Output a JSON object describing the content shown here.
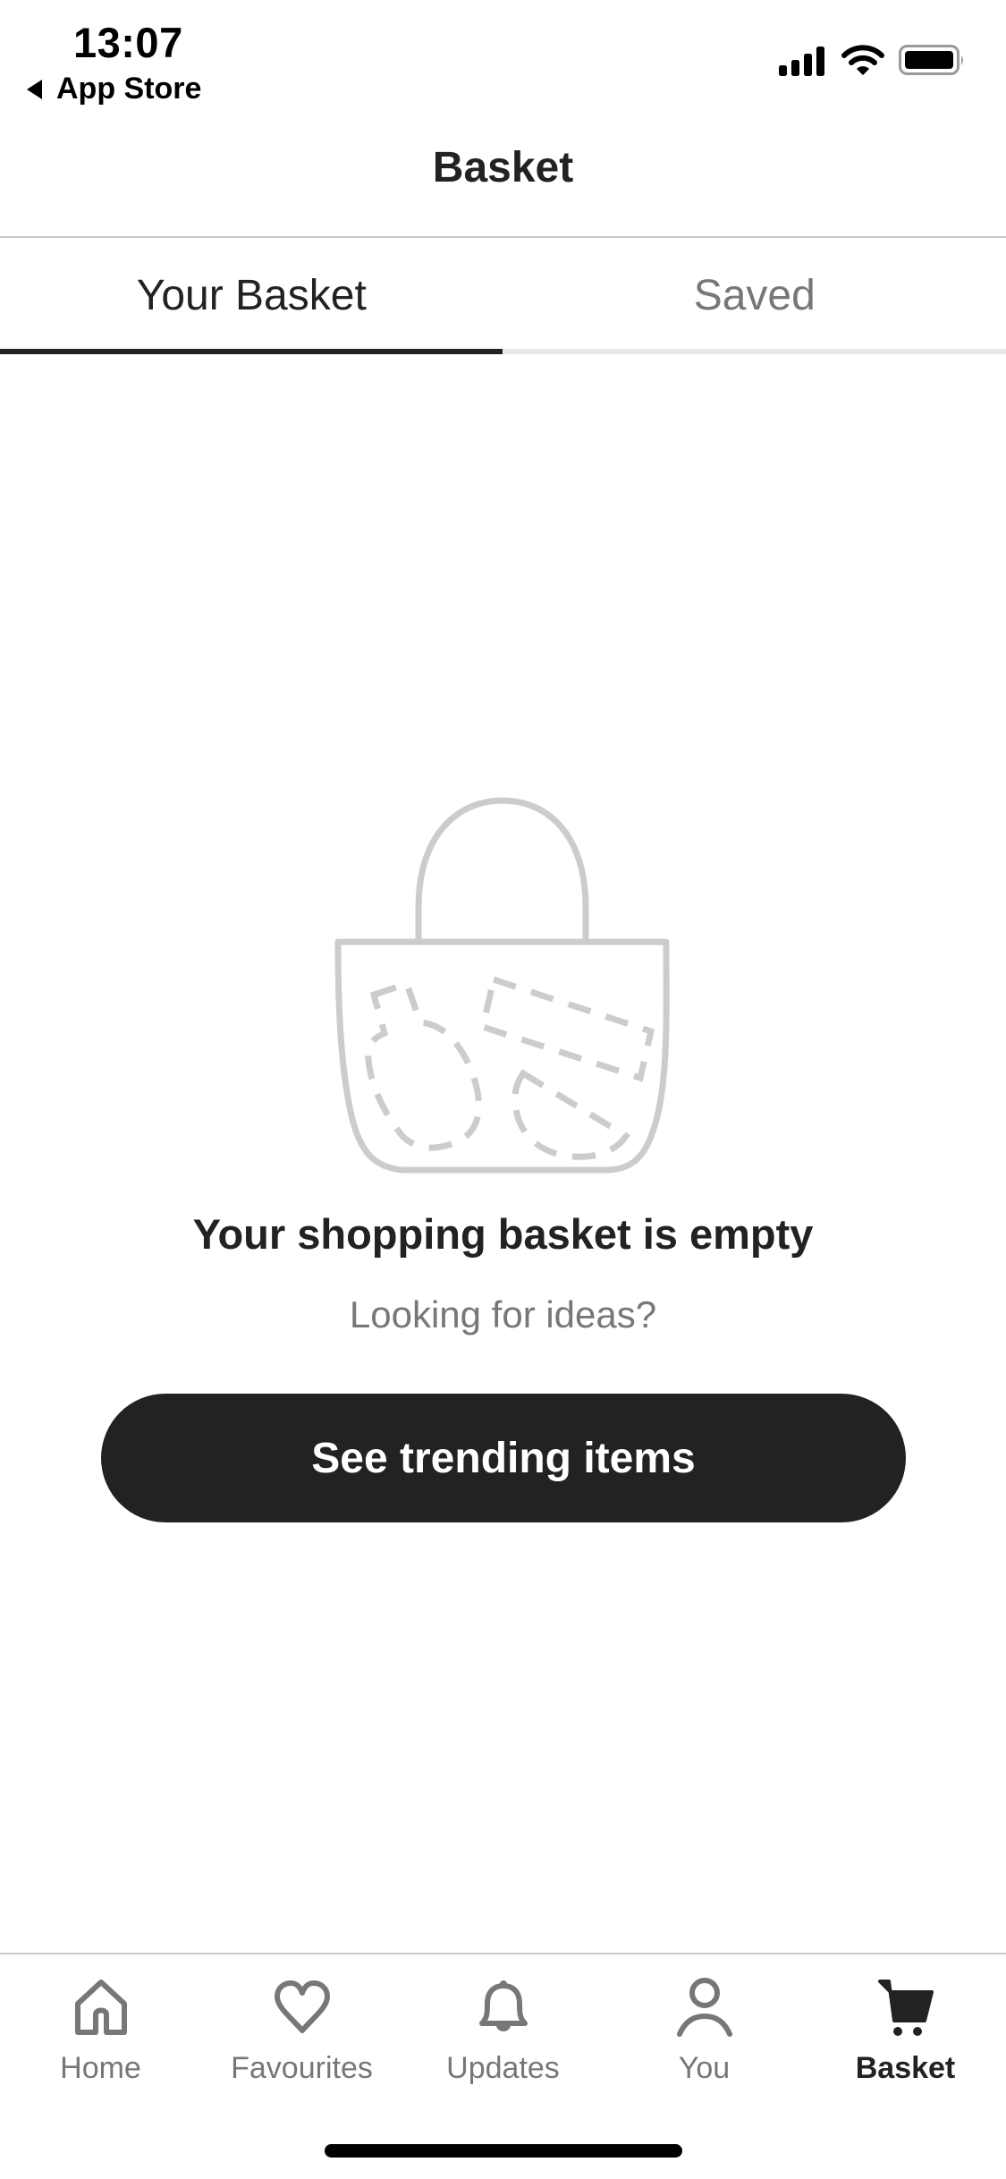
{
  "status_bar": {
    "time": "13:07",
    "back_label": "App Store",
    "icons": [
      "cellular-signal-icon",
      "wifi-icon",
      "battery-icon"
    ]
  },
  "nav": {
    "title": "Basket"
  },
  "tabs": [
    {
      "label": "Your Basket",
      "active": true
    },
    {
      "label": "Saved",
      "active": false
    }
  ],
  "empty_state": {
    "illustration": "empty-basket-illustration",
    "title": "Your shopping basket is empty",
    "subtitle": "Looking for ideas?",
    "cta_label": "See trending items"
  },
  "tabbar": {
    "items": [
      {
        "label": "Home",
        "icon": "home-icon",
        "active": false
      },
      {
        "label": "Favourites",
        "icon": "heart-icon",
        "active": false
      },
      {
        "label": "Updates",
        "icon": "bell-icon",
        "active": false
      },
      {
        "label": "You",
        "icon": "person-icon",
        "active": false
      },
      {
        "label": "Basket",
        "icon": "cart-icon",
        "active": true
      }
    ]
  },
  "colors": {
    "primary_text": "#222222",
    "secondary_text": "#777777",
    "button_bg": "#222222",
    "illustration_stroke": "#cccccc",
    "divider": "#c8c8c8"
  }
}
